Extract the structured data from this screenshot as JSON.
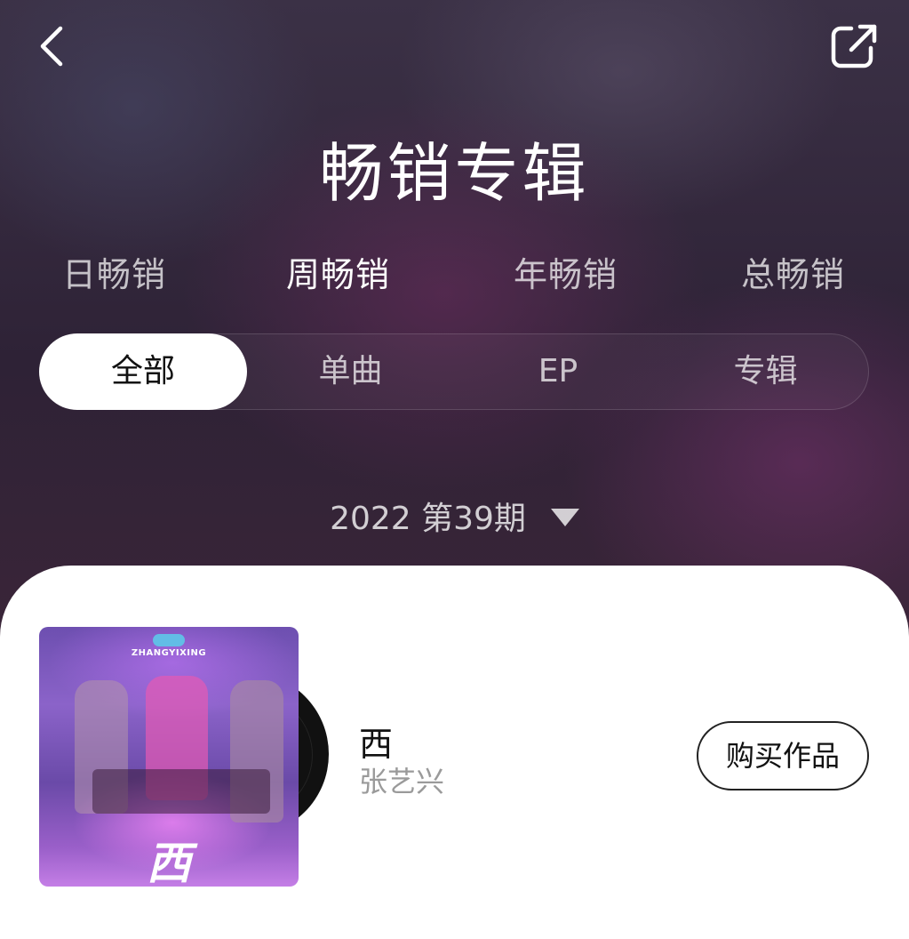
{
  "header": {
    "title": "畅销专辑",
    "back_icon": "chevron-left-icon",
    "share_icon": "share-external-icon"
  },
  "period_tabs": [
    {
      "label": "日畅销",
      "active": false
    },
    {
      "label": "周畅销",
      "active": true
    },
    {
      "label": "年畅销",
      "active": false
    },
    {
      "label": "总畅销",
      "active": false
    }
  ],
  "type_filter": [
    {
      "label": "全部",
      "active": true
    },
    {
      "label": "单曲",
      "active": false
    },
    {
      "label": "EP",
      "active": false
    },
    {
      "label": "专辑",
      "active": false
    }
  ],
  "period_selector": {
    "label": "2022 第39期",
    "icon": "caret-down-icon"
  },
  "items": [
    {
      "cover_text": "ZHANGYIXING",
      "cover_glyph": "西",
      "title": "西",
      "artist": "张艺兴",
      "buy_label": "购买作品"
    }
  ],
  "colors": {
    "card_bg": "#ffffff",
    "active_pill_bg": "#ffffff",
    "artist_text": "#9a9a9a"
  }
}
